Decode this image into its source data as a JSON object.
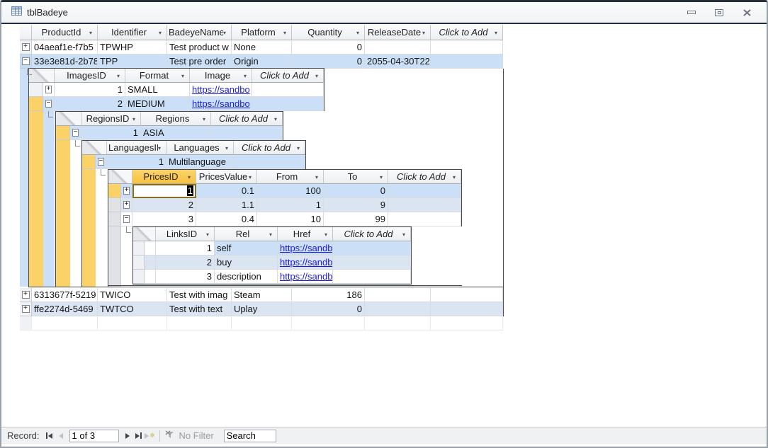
{
  "window": {
    "title": "tblBadeye"
  },
  "icons": {
    "dropdown_arrow": "▾",
    "expand_plus": "+",
    "expand_minus": "−",
    "new_record_star": "✱"
  },
  "colors": {
    "selection_row": "#CBE0F7",
    "alternate_row": "#DBE5F1",
    "active_path_selector": "#FBD267",
    "active_column_header": "#F8C23F",
    "hyperlink": "#1A1AE6"
  },
  "main": {
    "headers": [
      "ProductId",
      "Identifier",
      "BadeyeName",
      "Platform",
      "Quantity",
      "ReleaseDate",
      "Click to Add"
    ],
    "rows": [
      {
        "cells": [
          "04aeaf1e-f7b5",
          "TPWHP",
          "Test product w",
          "None",
          "0",
          "",
          ""
        ]
      },
      {
        "cells": [
          "33e3e81d-2b78",
          "TPP",
          "Test pre order",
          "Origin",
          "0",
          "2055-04-30T22:",
          ""
        ]
      },
      {
        "cells": [
          "6313677f-5219",
          "TWICO",
          "Test with imag",
          "Steam",
          "186",
          "",
          ""
        ]
      },
      {
        "cells": [
          "ffe2274d-5469",
          "TWTCO",
          "Test with text",
          "Uplay",
          "0",
          "",
          ""
        ]
      }
    ]
  },
  "images": {
    "headers": [
      "ImagesID",
      "Format",
      "Image",
      "Click to Add"
    ],
    "rows": [
      {
        "id": "1",
        "format": "SMALL",
        "image": "https://sandbo"
      },
      {
        "id": "2",
        "format": "MEDIUM",
        "image": "https://sandbo"
      }
    ]
  },
  "regions": {
    "headers": [
      "RegionsID",
      "Regions",
      "Click to Add"
    ],
    "rows": [
      {
        "id": "1",
        "region": "ASIA"
      }
    ]
  },
  "languages": {
    "headers": [
      "LanguagesID",
      "Languages",
      "Click to Add"
    ],
    "rows": [
      {
        "id": "1",
        "language": "Multilanguage"
      }
    ]
  },
  "prices": {
    "headers": [
      "PricesID",
      "PricesValue",
      "From",
      "To",
      "Click to Add"
    ],
    "rows": [
      {
        "id": "1",
        "value": "0.1",
        "from": "100",
        "to": "0"
      },
      {
        "id": "2",
        "value": "1.1",
        "from": "1",
        "to": "9"
      },
      {
        "id": "3",
        "value": "0.4",
        "from": "10",
        "to": "99"
      }
    ]
  },
  "links": {
    "headers": [
      "LinksID",
      "Rel",
      "Href",
      "Click to Add"
    ],
    "rows": [
      {
        "id": "1",
        "rel": "self",
        "href": "https://sandbo"
      },
      {
        "id": "2",
        "rel": "buy",
        "href": "https://sandbo"
      },
      {
        "id": "3",
        "rel": "description",
        "href": "https://sandbo"
      }
    ]
  },
  "nav": {
    "record_label": "Record:",
    "position": "1 of 3",
    "no_filter_label": "No Filter",
    "search_value": "Search"
  }
}
